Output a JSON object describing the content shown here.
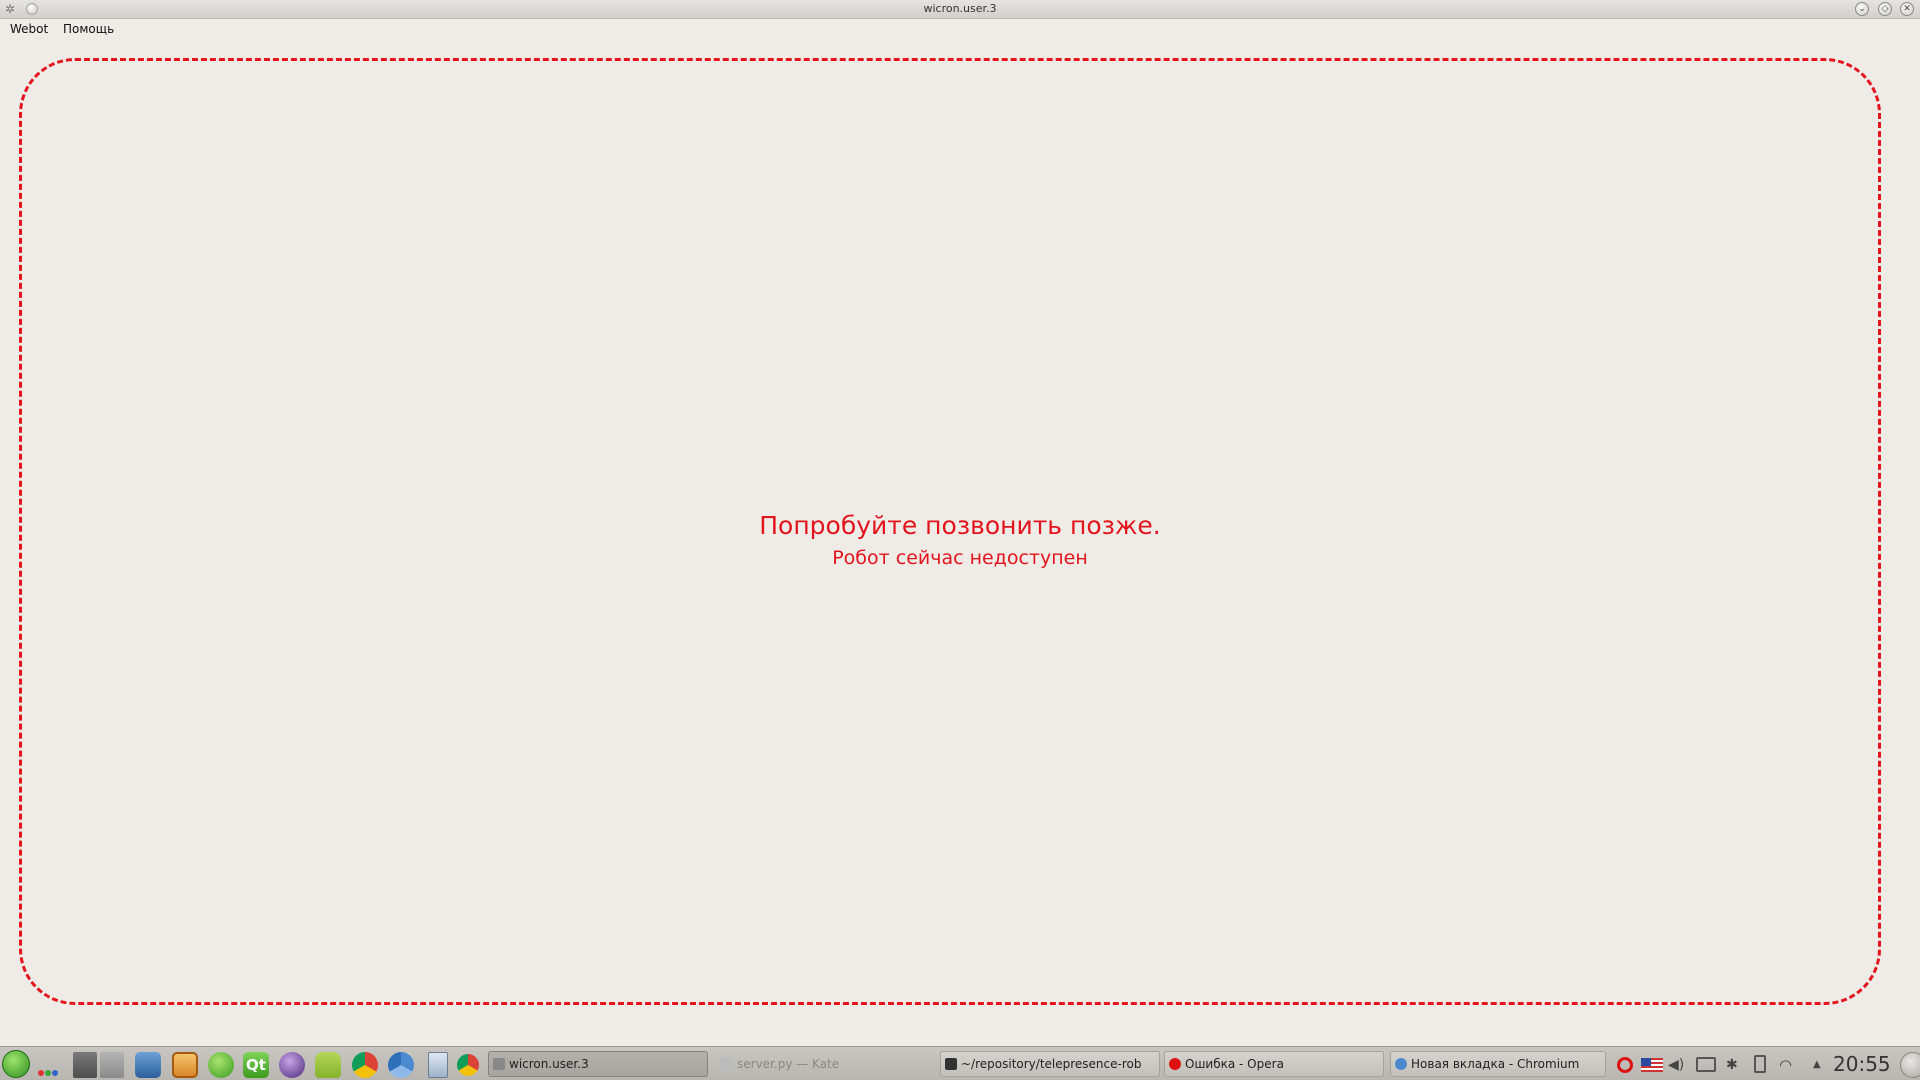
{
  "window": {
    "title": "wicron.user.3",
    "controls": {
      "minimize": "⌄",
      "maximize": "◇",
      "close": "✕"
    }
  },
  "menu": {
    "items": [
      {
        "label": "Webot"
      },
      {
        "label": "Помощь"
      }
    ]
  },
  "main": {
    "message_primary": "Попробуйте позвонить позже.",
    "message_secondary": "Робот сейчас недоступен",
    "accent_color": "#e3141b"
  },
  "taskbar": {
    "launchers": [
      {
        "icon": "start-menu-icon"
      },
      {
        "icon": "dots-icon"
      },
      {
        "icon": "desktop-1-icon"
      },
      {
        "icon": "desktop-2-icon"
      },
      {
        "icon": "vm-icon"
      },
      {
        "icon": "virtualbox-icon"
      },
      {
        "icon": "home-icon"
      },
      {
        "icon": "qt-creator-icon",
        "label": "Qt"
      },
      {
        "icon": "eclipse-icon"
      },
      {
        "icon": "android-icon"
      },
      {
        "icon": "chrome-icon"
      },
      {
        "icon": "chromium-icon"
      },
      {
        "icon": "file-icon"
      },
      {
        "icon": "chrome-icon"
      }
    ],
    "tasks": [
      {
        "label": "wicron.user.3",
        "state": "active",
        "icon": "app-icon"
      },
      {
        "label": "server.py — Kate",
        "state": "dim",
        "icon": "kate-icon"
      },
      {
        "label": "~/repository/telepresence-rob",
        "state": "normal",
        "icon": "terminal-icon"
      },
      {
        "label": "Ошибка - Opera",
        "state": "normal",
        "icon": "opera-icon"
      },
      {
        "label": "Новая вкладка - Chromium",
        "state": "normal",
        "icon": "chromium-icon"
      }
    ],
    "tray": [
      "opera-icon",
      "us-flag-icon",
      "volume-icon",
      "network-icon",
      "bluetooth-icon",
      "battery-icon",
      "wifi-icon",
      "expand-arrow-icon"
    ],
    "clock": "20:55"
  }
}
